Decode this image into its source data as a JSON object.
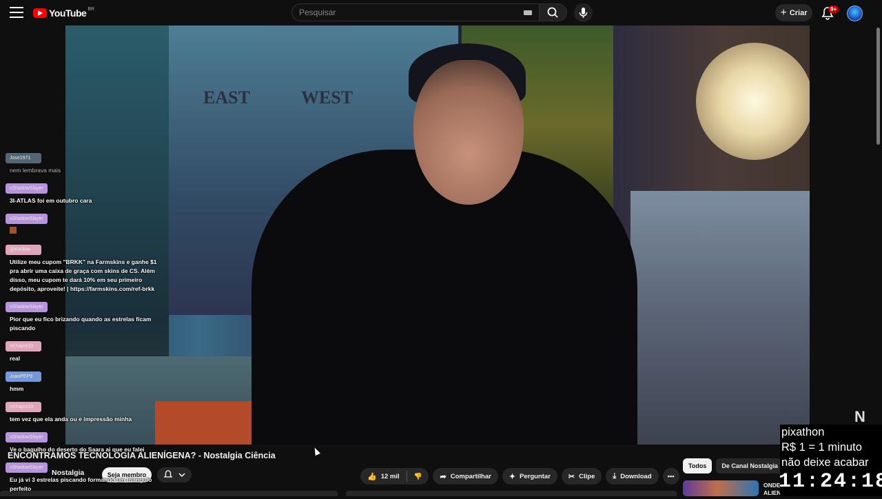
{
  "header": {
    "logo_text": "YouTube",
    "country_code": "BR",
    "search_placeholder": "Pesquisar",
    "create_label": "Criar",
    "notifications_badge": "9+"
  },
  "video": {
    "scene_text_east": "EAST",
    "scene_text_west": "WEST",
    "watermark": "N"
  },
  "chat": {
    "messages": [
      {
        "user": "Jose1971",
        "text": "nem lembrava mais",
        "color": "#5c7080"
      },
      {
        "user": "xShadowSlayer",
        "text": "3I-ATLAS foi em outubro cara",
        "color": "#c9a2f0"
      },
      {
        "user": "xShadowSlayer",
        "text": "",
        "color": "#c9a2f0"
      },
      {
        "user": "@KIKMar",
        "text": "Utilize meu cupom \"BRKK\" na Farmskins e ganhe $1 pra abrir uma caixa de graça com skins de CS. Além disso, meu cupom te dará 10% em seu primeiro depósito, aproveite! | https://farmskins.com/ref-brkk",
        "color": "#f7b6cd"
      },
      {
        "user": "xShadowSlayer",
        "text": "Pior que eu fico brizando quando as estrelas ficam piscando",
        "color": "#c9a2f0"
      },
      {
        "user": "nKhapro33",
        "text": "real",
        "color": "#f7b6cd"
      },
      {
        "user": "JoaoPEP9",
        "text": "hmm",
        "color": "#7fa7f0"
      },
      {
        "user": "nKhapro33",
        "text": "tem vez que ela anda ou e impressão minha",
        "color": "#f7b6cd"
      },
      {
        "user": "xShadowSlayer",
        "text": "Ve o bagulho do deserto do Saara ai que eu falei",
        "color": "#c9a2f0"
      },
      {
        "user": "xShadowSlayer",
        "text": "Eu já vi 3 estrelas piscando formando um triangulo perfeito",
        "color": "#c9a2f0"
      }
    ]
  },
  "below_video": {
    "title": "ENCONTRAMOS TECNOLOGIA ALIENÍGENA? - Nostalgia Ciência",
    "channel_name": "Nostalgia",
    "join_label": "Seja membro",
    "like_count": "12 mil",
    "share_label": "Compartilhar",
    "ask_label": "Perguntar",
    "clip_label": "Clipe",
    "download_label": "Download"
  },
  "recommendations": {
    "chips": [
      "Todos",
      "De Canal Nostalgia"
    ],
    "first_video_title": "ONDE ESTÃO TODOS OS ALIENÍGENAS? Com Kamal e"
  },
  "stream_overlay": {
    "lines": [
      "pixathon",
      "R$ 1 = 1 minuto",
      "não deixe acabar"
    ],
    "timer": "11:24:18"
  }
}
